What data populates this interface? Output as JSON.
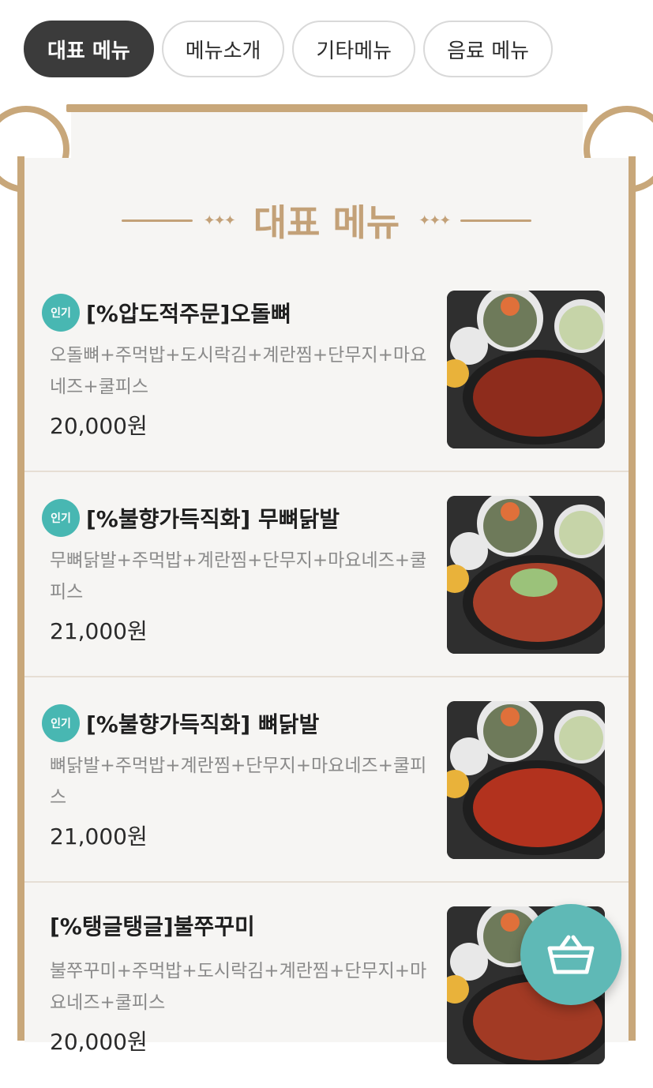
{
  "tabs": [
    {
      "label": "대표 메뉴",
      "active": true
    },
    {
      "label": "메뉴소개",
      "active": false
    },
    {
      "label": "기타메뉴",
      "active": false
    },
    {
      "label": "음료 메뉴",
      "active": false
    }
  ],
  "section": {
    "title": "대표 메뉴"
  },
  "items": [
    {
      "badge": "인기",
      "name": "[%압도적주문]오돌뼈",
      "desc": "오돌뼈+주먹밥+도시락김+계란찜+단무지+마요네즈+쿨피스",
      "price": "20,000원"
    },
    {
      "badge": "인기",
      "name": "[%불향가득직화]  무뼈닭발",
      "desc": "무뼈닭발+주먹밥+계란찜+단무지+마요네즈+쿨피스",
      "price": "21,000원"
    },
    {
      "badge": "인기",
      "name": "[%불향가득직화]  뼈닭발",
      "desc": "뼈닭발+주먹밥+계란찜+단무지+마요네즈+쿨피스",
      "price": "21,000원"
    },
    {
      "badge": "",
      "name": "[%탱글탱글]불쭈꾸미",
      "desc": "불쭈꾸미+주먹밥+도시락김+계란찜+단무지+마요네즈+쿨피스",
      "price": "20,000원"
    }
  ],
  "cart": {
    "icon": "basket-icon"
  },
  "colors": {
    "accent_gold": "#c3a178",
    "badge_teal": "#48b7b2",
    "cart_teal": "#5fb9b6",
    "tab_active": "#3b3b3b"
  }
}
